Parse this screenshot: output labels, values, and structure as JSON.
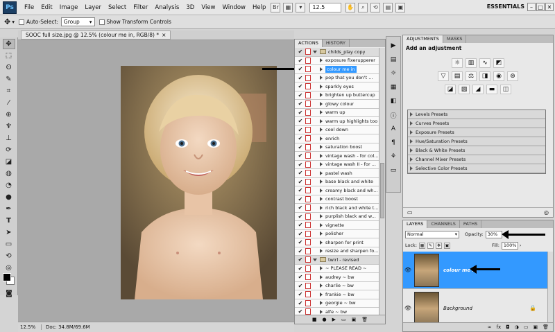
{
  "app": {
    "logo": "Ps"
  },
  "menu": [
    "File",
    "Edit",
    "Image",
    "Layer",
    "Select",
    "Filter",
    "Analysis",
    "3D",
    "View",
    "Window",
    "Help"
  ],
  "menubar": {
    "zoom": "12.5",
    "workspace": "ESSENTIALS",
    "br_badge": "Br"
  },
  "options": {
    "auto_select_label": "Auto-Select:",
    "auto_select_value": "Group",
    "transform_label": "Show Transform Controls"
  },
  "document": {
    "tab_title": "SOOC full size.jpg @ 12.5% (colour me in, RGB/8) *",
    "zoom": "12.5%",
    "doc_size": "Doc: 34.8M/69.6M"
  },
  "actions_panel": {
    "tabs": [
      "ACTIONS",
      "HISTORY"
    ],
    "rows": [
      {
        "type": "set",
        "label": "childs_play copy"
      },
      {
        "type": "item",
        "label": "exposure fixerupperer"
      },
      {
        "type": "item",
        "label": "colour me in",
        "selected": true
      },
      {
        "type": "item",
        "label": "pop that you don't ..."
      },
      {
        "type": "item",
        "label": "sparkly eyes"
      },
      {
        "type": "item",
        "label": "brighten up buttercup"
      },
      {
        "type": "item",
        "label": "glowy colour"
      },
      {
        "type": "item",
        "label": "warm up"
      },
      {
        "type": "item",
        "label": "warm up highlights too"
      },
      {
        "type": "item",
        "label": "cool down"
      },
      {
        "type": "item",
        "label": "enrich"
      },
      {
        "type": "item",
        "label": "saturation boost"
      },
      {
        "type": "item",
        "label": "vintage wash - for col..."
      },
      {
        "type": "item",
        "label": "vintage wash II - for ..."
      },
      {
        "type": "item",
        "label": "pastel wash"
      },
      {
        "type": "item",
        "label": "base black and white"
      },
      {
        "type": "item",
        "label": "creamy black and wh..."
      },
      {
        "type": "item",
        "label": "contrast boost"
      },
      {
        "type": "item",
        "label": "rich black and white t..."
      },
      {
        "type": "item",
        "label": "purplish black and w..."
      },
      {
        "type": "item",
        "label": "vignette"
      },
      {
        "type": "item",
        "label": "polisher"
      },
      {
        "type": "item",
        "label": "sharpen for print"
      },
      {
        "type": "item",
        "label": "resize and sharpen fo..."
      },
      {
        "type": "set",
        "label": "twirl - revised"
      },
      {
        "type": "item",
        "label": "~ PLEASE READ ~"
      },
      {
        "type": "item",
        "label": "audrey ~ bw"
      },
      {
        "type": "item",
        "label": "charlie ~ bw"
      },
      {
        "type": "item",
        "label": "frankie ~ bw"
      },
      {
        "type": "item",
        "label": "georgie ~ bw"
      },
      {
        "type": "item",
        "label": "alfe ~ bw"
      }
    ]
  },
  "adjustments_panel": {
    "tabs": [
      "ADJUSTMENTS",
      "MASKS"
    ],
    "title": "Add an adjustment",
    "presets": [
      "Levels Presets",
      "Curves Presets",
      "Exposure Presets",
      "Hue/Saturation Presets",
      "Black & White Presets",
      "Channel Mixer Presets",
      "Selective Color Presets"
    ]
  },
  "layers_panel": {
    "tabs": [
      "LAYERS",
      "CHANNELS",
      "PATHS"
    ],
    "blend_mode": "Normal",
    "opacity_label": "Opacity:",
    "opacity_value": "30%",
    "lock_label": "Lock:",
    "fill_label": "Fill:",
    "fill_value": "100%",
    "layers": [
      {
        "name": "colour me in",
        "selected": true
      },
      {
        "name": "Background",
        "selected": false
      }
    ]
  }
}
